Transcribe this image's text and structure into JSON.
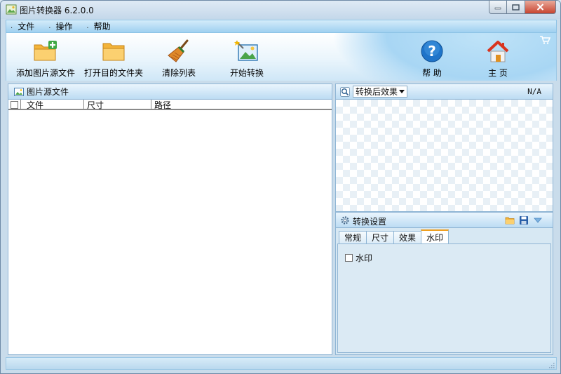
{
  "window": {
    "title": "图片转换器 6.2.0.0"
  },
  "menu": {
    "items": [
      {
        "label": "文件"
      },
      {
        "label": "操作"
      },
      {
        "label": "帮助"
      }
    ]
  },
  "toolbar": {
    "add_label": "添加图片源文件",
    "open_folder_label": "打开目的文件夹",
    "clear_label": "清除列表",
    "start_label": "开始转换",
    "help_label": "帮 助",
    "home_label": "主 页"
  },
  "source_panel": {
    "title": "图片源文件",
    "columns": [
      "文件",
      "尺寸",
      "路径"
    ]
  },
  "preview_panel": {
    "mode_selected": "转换后效果",
    "dimension_text": "N/A"
  },
  "settings_panel": {
    "title": "转换设置",
    "tabs": [
      "常规",
      "尺寸",
      "效果",
      "水印"
    ],
    "active_tab": "水印",
    "watermark_checkbox_label": "水印"
  },
  "colors": {
    "accent": "#f0a020",
    "panel_border": "#8fb5d4"
  }
}
